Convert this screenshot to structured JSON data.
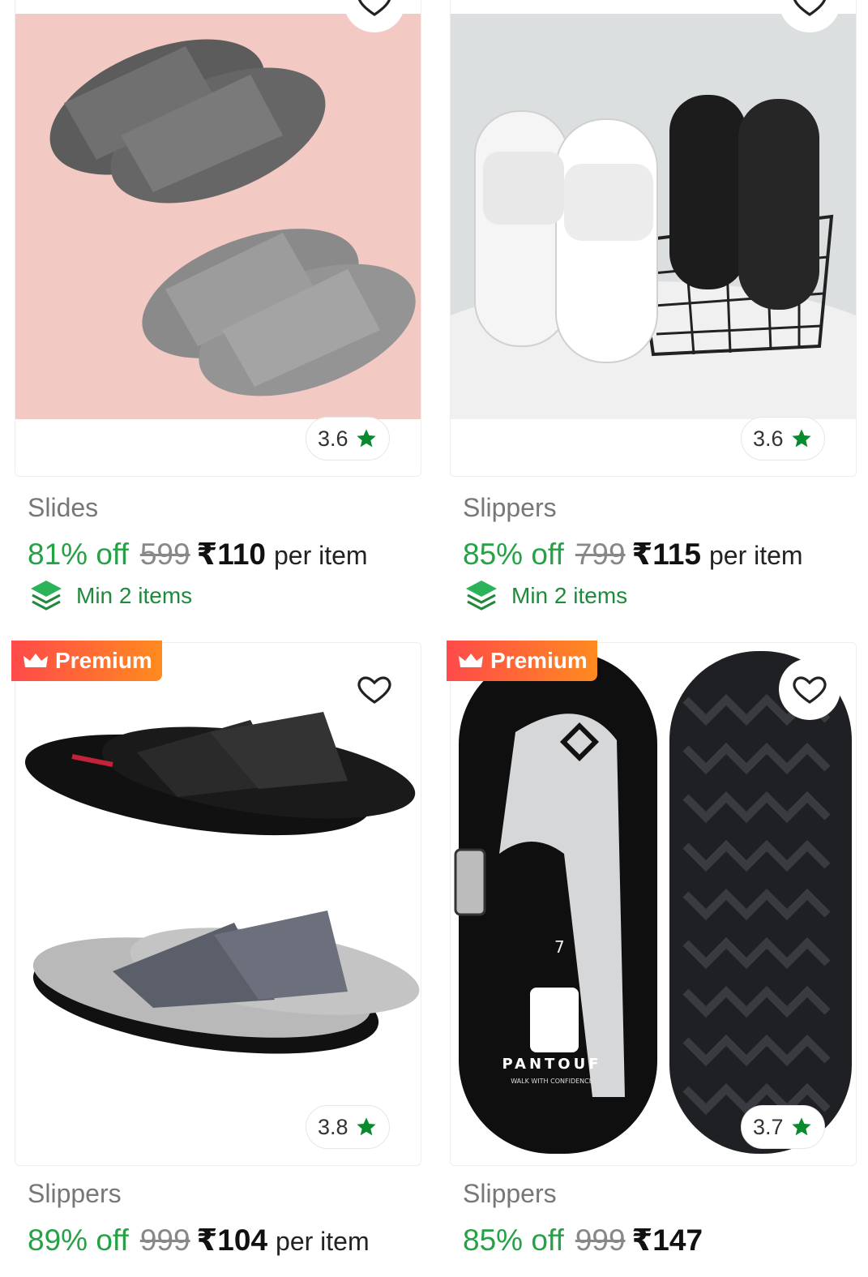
{
  "products": [
    {
      "name": "Slides",
      "rating": "3.6",
      "discount": "81% off",
      "mrp": "599",
      "price": "₹110",
      "per_item": "per item",
      "min_items": "Min 2 items"
    },
    {
      "name": "Slippers",
      "rating": "3.6",
      "discount": "85% off",
      "mrp": "799",
      "price": "₹115",
      "per_item": "per item",
      "min_items": "Min 2 items"
    },
    {
      "name": "Slippers",
      "badge": "Premium",
      "rating": "3.8",
      "discount": "89% off",
      "mrp": "999",
      "price": "₹104",
      "per_item": "per item"
    },
    {
      "name": "Slippers",
      "badge": "Premium",
      "rating": "3.7",
      "discount": "85% off",
      "mrp": "999",
      "price": "₹147",
      "brand_on_image": "PANTOUF",
      "brand_tagline": "WALK WITH CONFIDENCE",
      "size_on_image": "7"
    }
  ],
  "colors": {
    "discount_green": "#26a146",
    "rating_star_green": "#0a8a2e",
    "premium_gradient": [
      "#ff4a4a",
      "#ff8a1f"
    ]
  },
  "icons": {
    "wishlist": "heart-outline-icon",
    "rating": "star-icon",
    "min_items": "stack-layers-icon",
    "premium": "crown-icon"
  }
}
